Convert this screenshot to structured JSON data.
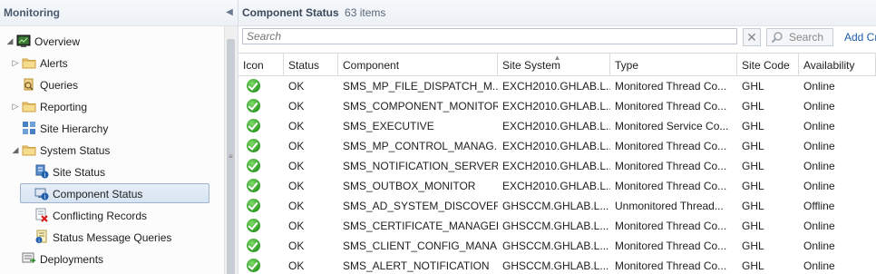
{
  "nav": {
    "title": "Monitoring",
    "collapse_glyph": "◀",
    "items": [
      {
        "label": "Overview",
        "icon": "overview-icon",
        "arrow": "◢",
        "level": 0
      },
      {
        "label": "Alerts",
        "icon": "folder-icon",
        "arrow": "▷",
        "level": 1
      },
      {
        "label": "Queries",
        "icon": "queries-icon",
        "arrow": "",
        "level": 1
      },
      {
        "label": "Reporting",
        "icon": "folder-icon",
        "arrow": "▷",
        "level": 1
      },
      {
        "label": "Site Hierarchy",
        "icon": "site-hierarchy-icon",
        "arrow": "",
        "level": 1
      },
      {
        "label": "System Status",
        "icon": "folder-icon",
        "arrow": "◢",
        "level": 1
      },
      {
        "label": "Site Status",
        "icon": "site-status-icon",
        "arrow": "",
        "level": 2
      },
      {
        "label": "Component Status",
        "icon": "component-status-icon",
        "arrow": "",
        "level": 2,
        "selected": true
      },
      {
        "label": "Conflicting Records",
        "icon": "conflicting-records-icon",
        "arrow": "",
        "level": 2
      },
      {
        "label": "Status Message Queries",
        "icon": "status-message-icon",
        "arrow": "",
        "level": 2
      },
      {
        "label": "Deployments",
        "icon": "deployments-icon",
        "arrow": "",
        "level": 1
      }
    ]
  },
  "content": {
    "title": "Component Status",
    "count": "63 items",
    "search": {
      "placeholder": "Search",
      "clear_glyph": "✕",
      "button_label": "Search",
      "add_criteria": "Add Cr"
    },
    "columns": [
      "Icon",
      "Status",
      "Component",
      "Site System",
      "Type",
      "Site Code",
      "Availability"
    ],
    "rows": [
      {
        "status": "OK",
        "component": "SMS_MP_FILE_DISPATCH_M...",
        "site_system": "EXCH2010.GHLAB.L...",
        "type": "Monitored Thread Co...",
        "site_code": "GHL",
        "availability": "Online"
      },
      {
        "status": "OK",
        "component": "SMS_COMPONENT_MONITOR",
        "site_system": "EXCH2010.GHLAB.L...",
        "type": "Monitored Thread Co...",
        "site_code": "GHL",
        "availability": "Online"
      },
      {
        "status": "OK",
        "component": "SMS_EXECUTIVE",
        "site_system": "EXCH2010.GHLAB.L...",
        "type": "Monitored Service Co...",
        "site_code": "GHL",
        "availability": "Online"
      },
      {
        "status": "OK",
        "component": "SMS_MP_CONTROL_MANAG...",
        "site_system": "EXCH2010.GHLAB.L...",
        "type": "Monitored Thread Co...",
        "site_code": "GHL",
        "availability": "Online"
      },
      {
        "status": "OK",
        "component": "SMS_NOTIFICATION_SERVER",
        "site_system": "EXCH2010.GHLAB.L...",
        "type": "Monitored Thread Co...",
        "site_code": "GHL",
        "availability": "Online"
      },
      {
        "status": "OK",
        "component": "SMS_OUTBOX_MONITOR",
        "site_system": "EXCH2010.GHLAB.L...",
        "type": "Monitored Thread Co...",
        "site_code": "GHL",
        "availability": "Online"
      },
      {
        "status": "OK",
        "component": "SMS_AD_SYSTEM_DISCOVER...",
        "site_system": "GHSCCM.GHLAB.L...",
        "type": "Unmonitored Thread...",
        "site_code": "GHL",
        "availability": "Offline"
      },
      {
        "status": "OK",
        "component": "SMS_CERTIFICATE_MANAGER",
        "site_system": "GHSCCM.GHLAB.L...",
        "type": "Monitored Thread Co...",
        "site_code": "GHL",
        "availability": "Online"
      },
      {
        "status": "OK",
        "component": "SMS_CLIENT_CONFIG_MANA...",
        "site_system": "GHSCCM.GHLAB.L...",
        "type": "Monitored Thread Co...",
        "site_code": "GHL",
        "availability": "Online"
      },
      {
        "status": "OK",
        "component": "SMS_ALERT_NOTIFICATION",
        "site_system": "GHSCCM.GHLAB.L...",
        "type": "Monitored Thread Co...",
        "site_code": "GHL",
        "availability": "Online"
      }
    ]
  }
}
